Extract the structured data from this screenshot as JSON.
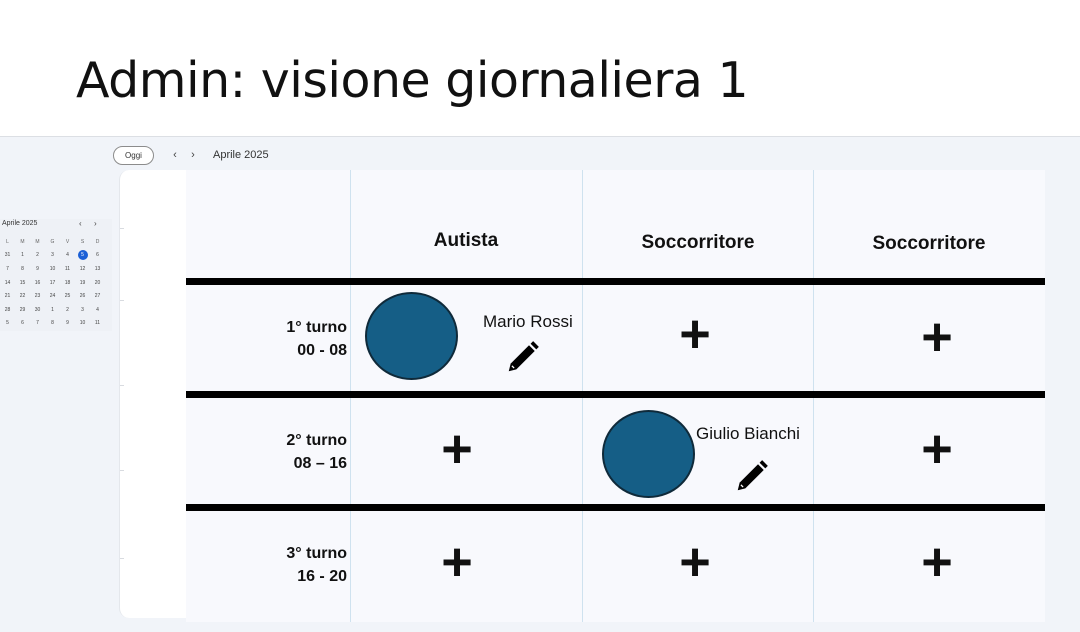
{
  "slide": {
    "title": "Admin: visione giornaliera 1"
  },
  "toolbar": {
    "today_label": "Oggi",
    "prev_icon": "‹",
    "next_icon": "›",
    "month": "Aprile 2025"
  },
  "mini_calendar": {
    "month": "Aprile 2025",
    "weekdays": [
      "L",
      "M",
      "M",
      "G",
      "V",
      "S",
      "D"
    ],
    "days": [
      "31",
      "1",
      "2",
      "3",
      "4",
      "5",
      "6",
      "7",
      "8",
      "9",
      "10",
      "11",
      "12",
      "13",
      "14",
      "15",
      "16",
      "17",
      "18",
      "19",
      "20",
      "21",
      "22",
      "23",
      "24",
      "25",
      "26",
      "27",
      "28",
      "29",
      "30",
      "1",
      "2",
      "3",
      "4",
      "5",
      "6",
      "7",
      "8",
      "9",
      "10",
      "11"
    ],
    "selected_day": "5"
  },
  "columns": [
    "Autista",
    "Soccorritore",
    "Soccorritore"
  ],
  "shifts": [
    {
      "name": "1° turno",
      "hours": "00 - 08"
    },
    {
      "name": "2° turno",
      "hours": "08 – 16"
    },
    {
      "name": "3° turno",
      "hours": "16 - 20"
    }
  ],
  "assignments": {
    "shift1_autista": "Mario Rossi",
    "shift2_soccorritore1": "Giulio Bianchi"
  },
  "icons": {
    "add": "+",
    "edit": "pencil-icon",
    "avatar": "avatar"
  },
  "colors": {
    "avatar_fill": "#155e86",
    "avatar_border": "#0f2a3a",
    "selected_day": "#1a5fd6",
    "grid_bg": "#f8f9fd",
    "column_divider": "#cfe2ef"
  }
}
